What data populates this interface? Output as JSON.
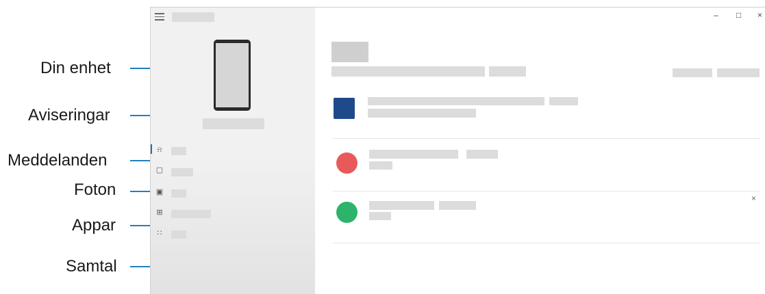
{
  "callouts": {
    "device": "Din enhet",
    "notifications": "Aviseringar",
    "messages": "Meddelanden",
    "photos": "Foton",
    "apps": "Appar",
    "calls": "Samtal"
  },
  "window_controls": {
    "minimize": "–",
    "maximize": "□",
    "close": "×"
  },
  "nav_icons": {
    "notifications": "bell-icon",
    "messages": "message-icon",
    "photos": "photo-icon",
    "apps": "apps-icon",
    "calls": "dialpad-icon"
  },
  "notification_close": "×",
  "colors": {
    "callout_line": "#1f7fbf",
    "app1": "#1f4a8a",
    "app2": "#e85a5a",
    "app3": "#2db36a",
    "active_nav": "#2a66c0"
  }
}
